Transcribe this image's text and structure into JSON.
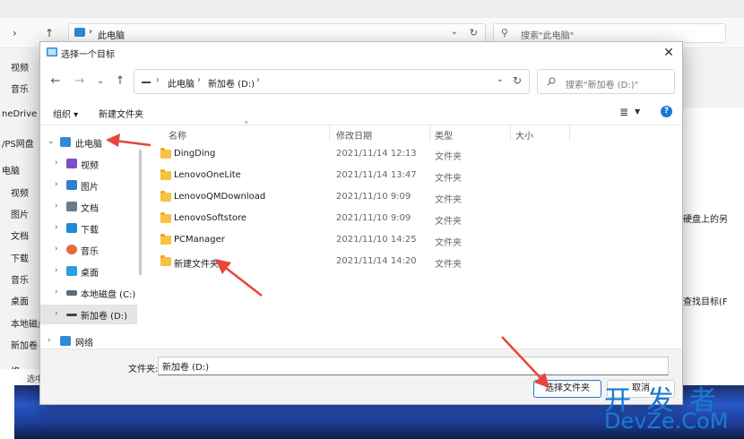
{
  "background": {
    "address_crumb": "此电脑",
    "search_placeholder": "搜索\"此电脑\"",
    "sidebar": [
      "视频",
      "音乐",
      "neDrive",
      "/PS网盘",
      "电脑",
      "视频",
      "图片",
      "文档",
      "下载",
      "音乐",
      "桌面",
      "本地磁盘",
      "新加卷 (",
      "络"
    ],
    "right_fragments": [
      "硬盘上的另",
      "查找目标(F"
    ],
    "status_fragment": "选中"
  },
  "dialog": {
    "title": "选择一个目标",
    "close_glyph": "✕",
    "address": {
      "crumbs": [
        "此电脑",
        "新加卷 (D:)"
      ]
    },
    "search_placeholder": "搜索\"新加卷 (D:)\"",
    "commands": {
      "organize": "组织 ▾",
      "new_folder": "新建文件夹"
    },
    "nav_tree": [
      {
        "label": "此电脑",
        "icon": "computer-icon",
        "color": "#2e8bd8"
      },
      {
        "label": "视频",
        "icon": "video-icon",
        "color": "#7b4fc9"
      },
      {
        "label": "图片",
        "icon": "pictures-icon",
        "color": "#2f7fd1"
      },
      {
        "label": "文档",
        "icon": "documents-icon",
        "color": "#6c7a89"
      },
      {
        "label": "下载",
        "icon": "download-icon",
        "color": "#1f8ad6"
      },
      {
        "label": "音乐",
        "icon": "music-icon",
        "color": "#e46b3d"
      },
      {
        "label": "桌面",
        "icon": "desktop-icon",
        "color": "#2aa1de"
      },
      {
        "label": "本地磁盘 (C:)",
        "icon": "drive-c-icon",
        "color": "#5a6b7d"
      },
      {
        "label": "新加卷 (D:)",
        "icon": "drive-d-icon",
        "color": "#444444"
      },
      {
        "label": "网络",
        "icon": "network-icon",
        "color": "#2e8bd8"
      }
    ],
    "columns": {
      "name": "名称",
      "modified": "修改日期",
      "type": "类型",
      "size": "大小"
    },
    "files": [
      {
        "name": "DingDing",
        "date": "2021/11/14 12:13",
        "type": "文件夹"
      },
      {
        "name": "LenovoOneLite",
        "date": "2021/11/14 13:47",
        "type": "文件夹"
      },
      {
        "name": "LenovoQMDownload",
        "date": "2021/11/10 9:09",
        "type": "文件夹"
      },
      {
        "name": "LenovoSoftstore",
        "date": "2021/11/10 9:09",
        "type": "文件夹"
      },
      {
        "name": "PCManager",
        "date": "2021/11/10 14:25",
        "type": "文件夹"
      },
      {
        "name": "新建文件夹",
        "date": "2021/11/14 14:20",
        "type": "文件夹"
      }
    ],
    "folder_label": "文件夹:",
    "folder_value": "新加卷 (D:)",
    "select_button": "选择文件夹",
    "cancel_button": "取消"
  },
  "watermark": {
    "cn": "开 发 者",
    "en": "DevZe.CoM"
  },
  "colors": {
    "accent": "#1e78d6",
    "arrow": "#e8453c",
    "folder": "#f6c343"
  }
}
